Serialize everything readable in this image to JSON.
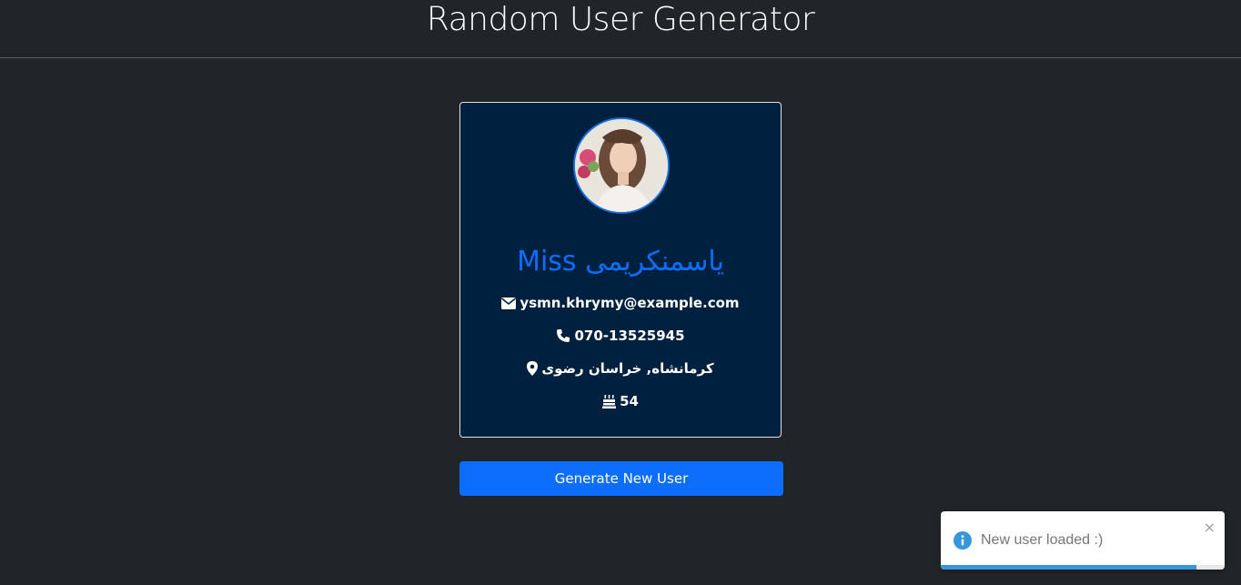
{
  "header": {
    "title": "Random User Generator"
  },
  "user": {
    "name": "Miss یاسمنکریمی",
    "email": "ysmn.khrymy@example.com",
    "phone": "070-13525945",
    "location": "کرمانشاه, خراسان رضوی",
    "age": "54"
  },
  "icons": {
    "email": "envelope-icon",
    "phone": "phone-icon",
    "location": "map-marker-icon",
    "age": "birthday-cake-icon"
  },
  "actions": {
    "generate_label": "Generate New User"
  },
  "toast": {
    "message": "New user loaded :)",
    "close": "×",
    "progress": 0.9
  },
  "colors": {
    "background": "#212529",
    "card": "#00203f",
    "accent": "#0d6efd",
    "toast_info": "#3498db"
  }
}
